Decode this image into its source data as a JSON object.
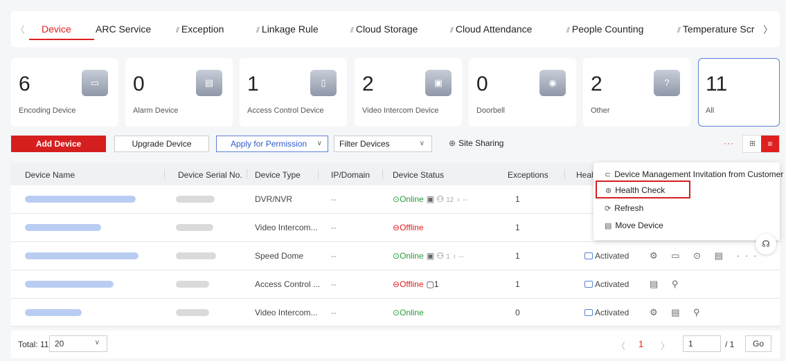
{
  "tabs": [
    {
      "label": "Device",
      "icon": ""
    },
    {
      "label": "ARC Service",
      "icon": ""
    },
    {
      "label": "Exception",
      "icon": "signal-icon"
    },
    {
      "label": "Linkage Rule",
      "icon": "signal-icon"
    },
    {
      "label": "Cloud Storage",
      "icon": "signal-icon"
    },
    {
      "label": "Cloud Attendance",
      "icon": "signal-icon"
    },
    {
      "label": "People Counting",
      "icon": "signal-icon"
    },
    {
      "label": "Temperature Scr",
      "icon": "signal-icon"
    }
  ],
  "icon_glyphs": {
    "signal": "⫽",
    "prev": "〈",
    "next": "〉"
  },
  "categories": [
    {
      "count": "6",
      "label": "Encoding Device",
      "icon": "nvr-icon",
      "glyph": "▭"
    },
    {
      "count": "0",
      "label": "Alarm Device",
      "icon": "alarm-panel-icon",
      "glyph": "▤"
    },
    {
      "count": "1",
      "label": "Access Control Device",
      "icon": "access-terminal-icon",
      "glyph": "▯"
    },
    {
      "count": "2",
      "label": "Video Intercom Device",
      "icon": "intercom-icon",
      "glyph": "▣"
    },
    {
      "count": "0",
      "label": "Doorbell",
      "icon": "doorbell-icon",
      "glyph": "◉"
    },
    {
      "count": "2",
      "label": "Other",
      "icon": "question-icon",
      "glyph": "?"
    },
    {
      "count": "11",
      "label": "All",
      "icon": "",
      "glyph": ""
    }
  ],
  "toolbar": {
    "add_device": "Add Device",
    "upgrade_device": "Upgrade Device",
    "apply_permission": "Apply for Permission",
    "filter_devices": "Filter Devices",
    "site_sharing": "Site Sharing",
    "more": "···",
    "chevron": "∨"
  },
  "table": {
    "headers": [
      "Device Name",
      "Device Serial No.",
      "Device Type",
      "IP/Domain",
      "Device Status",
      "Exceptions",
      "Healt"
    ],
    "rows": [
      {
        "type": "DVR/NVR",
        "ip": "--",
        "status": "Online",
        "status_kind": "online",
        "status_extra": "▣ ⚇",
        "status_dim": "12 ♁ --",
        "exceptions": "1",
        "activated": "",
        "ops": ""
      },
      {
        "type": "Video Intercom...",
        "ip": "--",
        "status": "Offline",
        "status_kind": "offline",
        "status_extra": "",
        "status_dim": "",
        "exceptions": "1",
        "activated": "",
        "ops": ""
      },
      {
        "type": "Speed Dome",
        "ip": "--",
        "status": "Online",
        "status_kind": "online",
        "status_extra": "▣ ⚇",
        "status_dim": "1 ♁ --",
        "exceptions": "1",
        "activated": "Activated",
        "ops": "⚙ ▭ ⊙ ▤ ···"
      },
      {
        "type": "Access Control ...",
        "ip": "--",
        "status": "Offline",
        "status_kind": "offline",
        "status_extra": "▢1",
        "status_dim": "",
        "exceptions": "1",
        "activated": "Activated",
        "ops": "▤ ⚲"
      },
      {
        "type": "Video Intercom...",
        "ip": "--",
        "status": "Online",
        "status_kind": "online",
        "status_extra": "",
        "status_dim": "",
        "exceptions": "0",
        "activated": "Activated",
        "ops": "⚙ ▤ ⚲"
      }
    ]
  },
  "menu": {
    "items": [
      {
        "label": "Device Management Invitation from Customer",
        "icon": "invitation-icon",
        "glyph": "⊂"
      },
      {
        "label": "Health Check",
        "icon": "health-check-icon",
        "glyph": "⊛"
      },
      {
        "label": "Refresh",
        "icon": "refresh-icon",
        "glyph": "⟳"
      },
      {
        "label": "Move Device",
        "icon": "move-device-icon",
        "glyph": "▤"
      }
    ]
  },
  "support_icon": "headset-icon",
  "pagination": {
    "total": "Total: 11",
    "page_size": "20",
    "current_page": "1",
    "page_input": "1",
    "total_pages": "/ 1",
    "go": "Go"
  },
  "colors": {
    "accent": "#e02020",
    "link_blue": "#2e5bd1",
    "online": "#2a9a3a"
  }
}
